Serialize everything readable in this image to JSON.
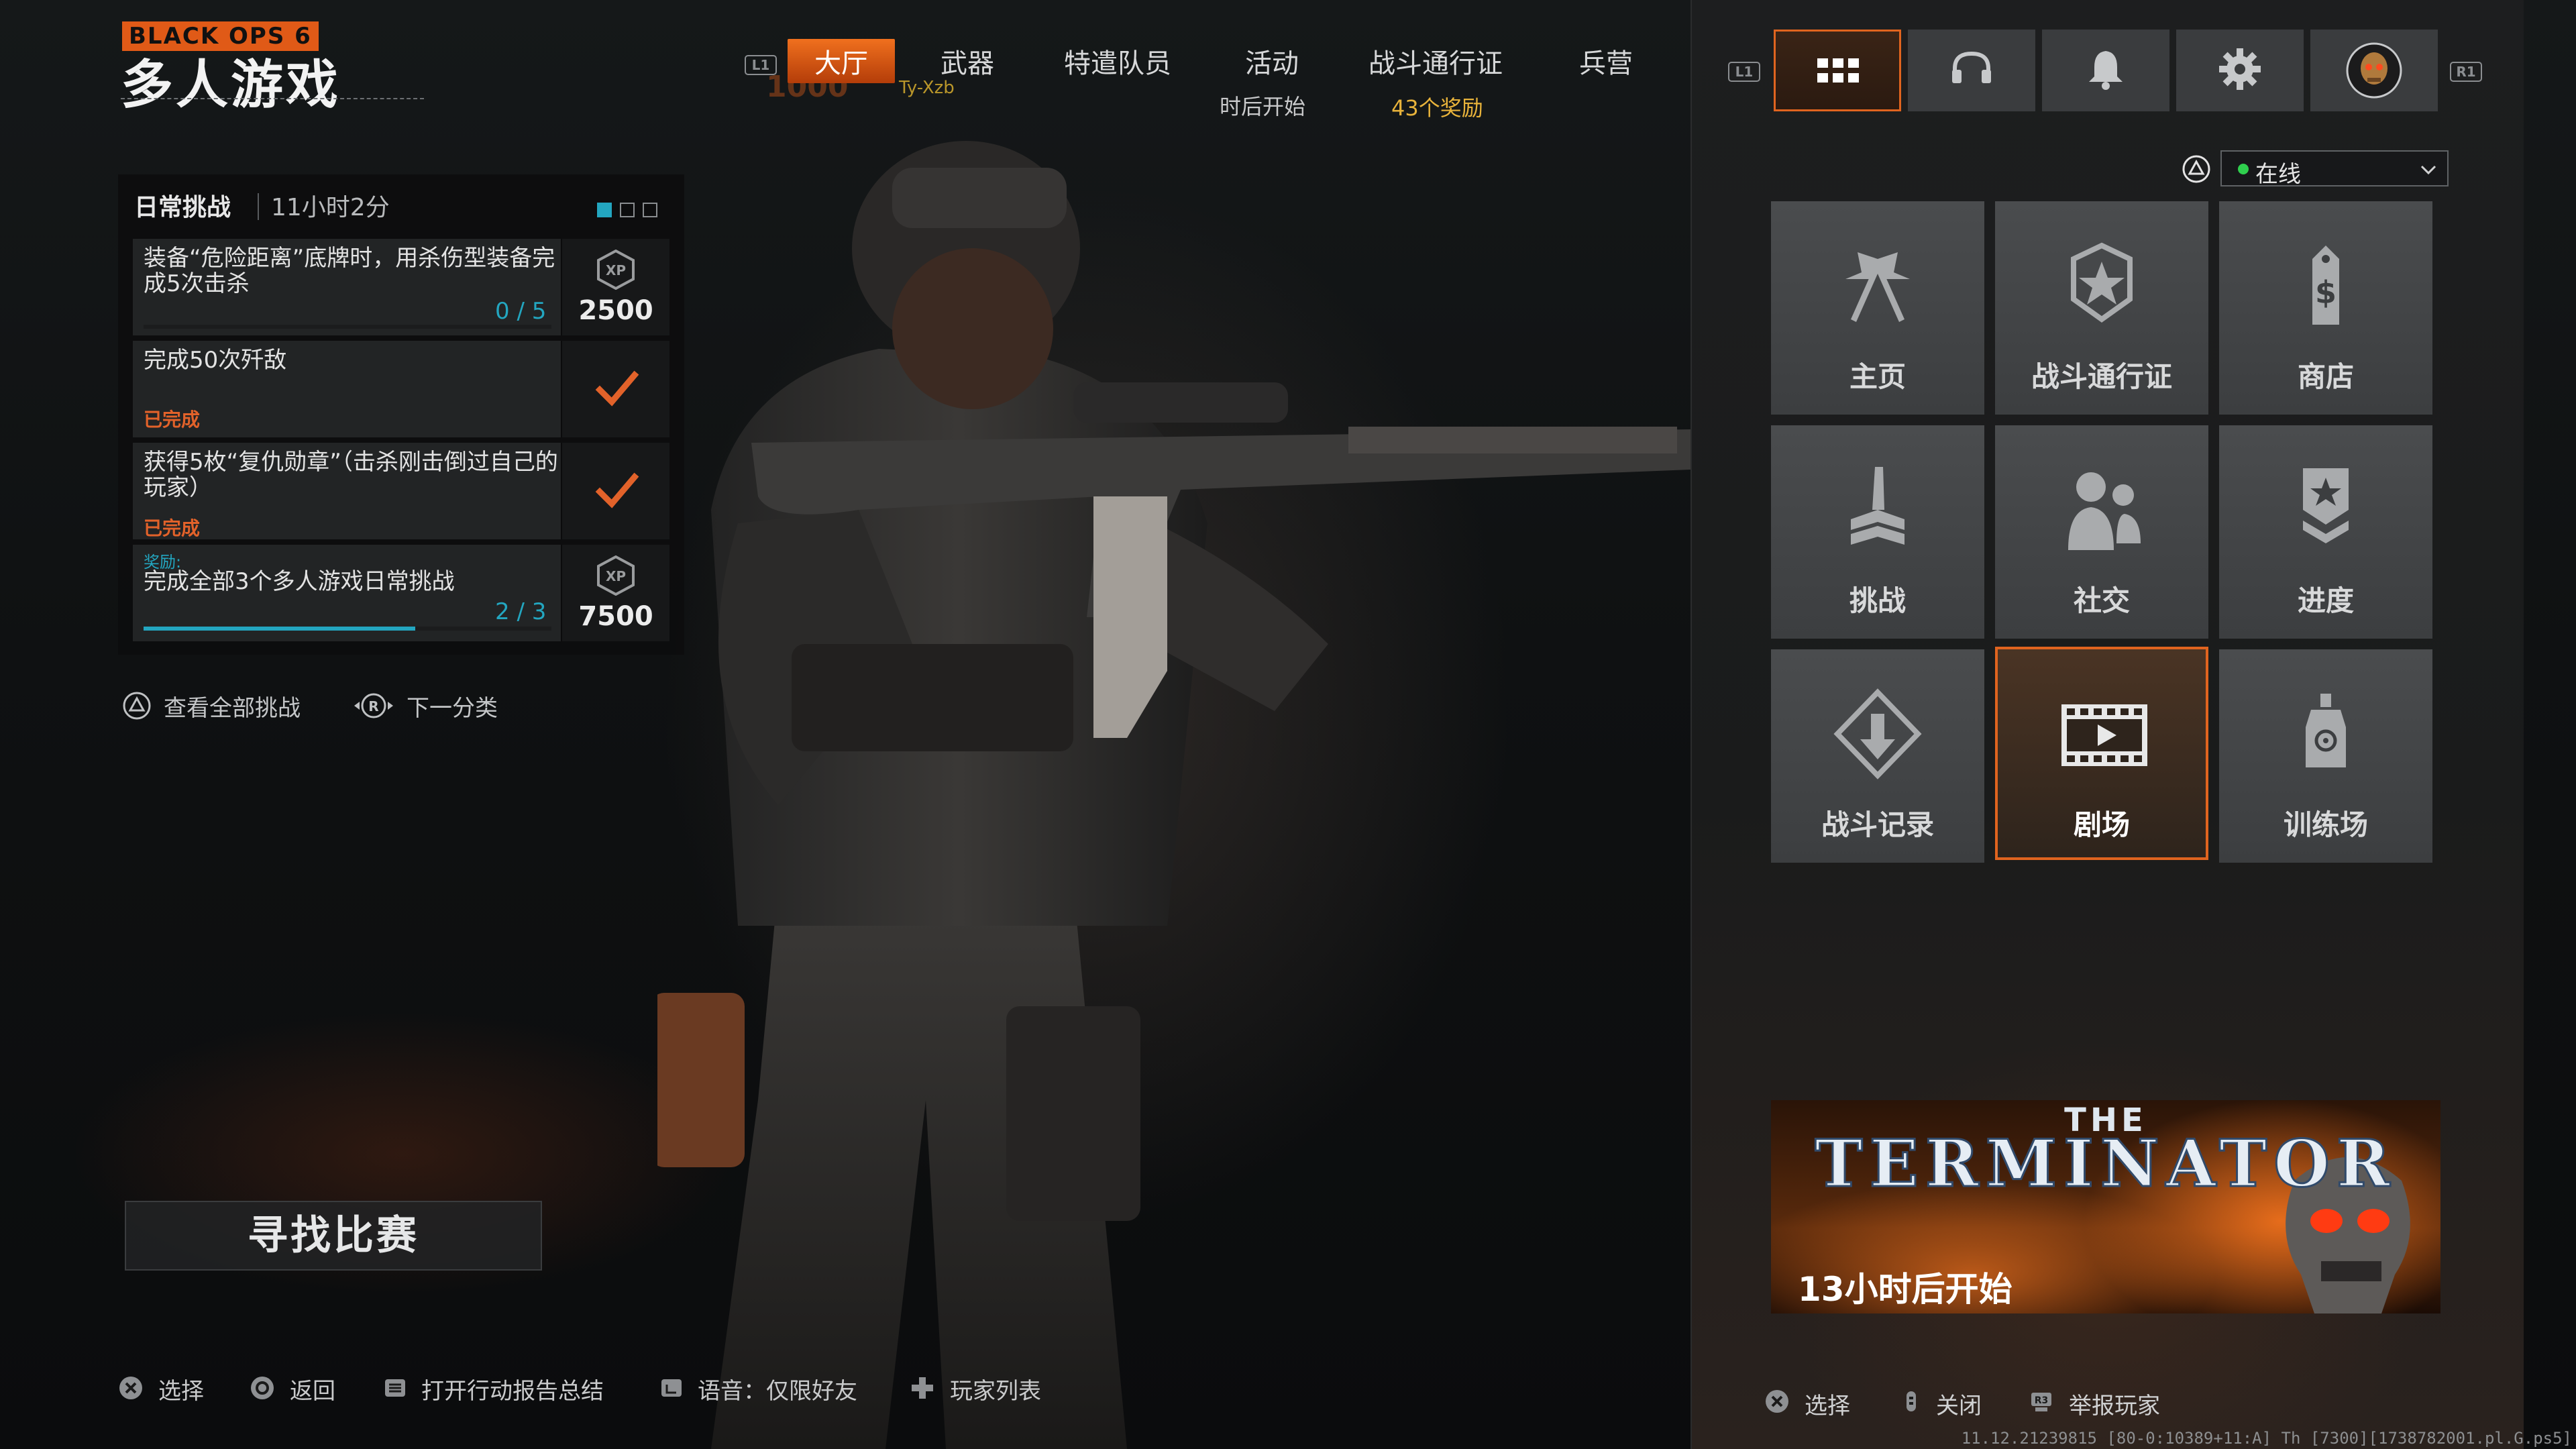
{
  "game": {
    "brand": "BLACK OPS 6",
    "mode_title": "多人游戏"
  },
  "nav": {
    "left_bumper": "L1",
    "tabs": [
      {
        "label": "大厅",
        "active": true
      },
      {
        "label": "武器"
      },
      {
        "label": "特遣队员"
      },
      {
        "label": "活动",
        "sub": "时后开始"
      },
      {
        "label": "战斗通行证",
        "sub": "43个奖励"
      },
      {
        "label": "兵营"
      }
    ],
    "player_tag": "Ty-Xzb",
    "player_level": "1000"
  },
  "challenges": {
    "heading": "日常挑战",
    "time_left": "11小时2分",
    "rows": [
      {
        "text": "装备“危险距离”底牌时，用杀伤型装备完成5次击杀",
        "progress": "0 / 5",
        "progress_fraction": 0.0,
        "xp": "2500",
        "xp_label": "XP"
      },
      {
        "text": "完成50次歼敌",
        "status": "已完成"
      },
      {
        "text": "获得5枚“复仇勋章”（击杀刚击倒过自己的玩家）",
        "status": "已完成"
      },
      {
        "reward_label": "奖励:",
        "text": "完成全部3个多人游戏日常挑战",
        "progress": "2 / 3",
        "progress_fraction": 0.6667,
        "xp": "7500",
        "xp_label": "XP"
      }
    ],
    "view_all": "查看全部挑战",
    "next_category": "下一分类"
  },
  "find_match": "寻找比赛",
  "footer_left": {
    "select": "选择",
    "back": "返回",
    "after_action": "打开行动报告总结",
    "voice": "语音：仅限好友",
    "player_list": "玩家列表"
  },
  "right_panel": {
    "left_bumper": "L1",
    "right_bumper": "R1",
    "iconbar": [
      "grid-icon",
      "headset-icon",
      "bell-icon",
      "gear-icon",
      "avatar"
    ],
    "status": "在线",
    "tiles": [
      {
        "label": "主页",
        "icon": "flags-icon"
      },
      {
        "label": "战斗通行证",
        "icon": "star-badge-icon"
      },
      {
        "label": "商店",
        "icon": "price-tag-icon"
      },
      {
        "label": "挑战",
        "icon": "knife-icon"
      },
      {
        "label": "社交",
        "icon": "people-icon"
      },
      {
        "label": "进度",
        "icon": "chevron-rank-icon"
      },
      {
        "label": "战斗记录",
        "icon": "combat-record-icon"
      },
      {
        "label": "剧场",
        "icon": "film-icon",
        "active": true
      },
      {
        "label": "训练场",
        "icon": "target-dummy-icon"
      }
    ],
    "banner": {
      "the": "THE",
      "title": "TERMINATOR",
      "subtitle": "13小时后开始"
    },
    "footer": {
      "select": "选择",
      "close": "关闭",
      "report": "举报玩家"
    }
  },
  "version": "11.12.21239815 [80-0:10389+11:A] Th [7300][1738782001.pl.G.ps5]",
  "colors": {
    "accent": "#e0641f",
    "cyan": "#23a6c0",
    "complete": "#e2622a",
    "online": "#2fcf4e"
  }
}
